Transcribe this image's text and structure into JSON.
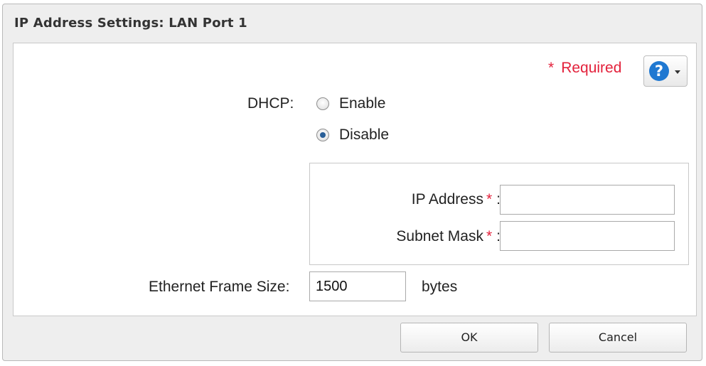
{
  "dialog": {
    "title": "IP Address Settings: LAN Port 1",
    "required_star": "*",
    "required_text": "Required",
    "help_icon_glyph": "?"
  },
  "dhcp": {
    "label": "DHCP:",
    "options": [
      {
        "label": "Enable",
        "checked": false
      },
      {
        "label": "Disable",
        "checked": true
      }
    ]
  },
  "fields": {
    "ip_address": {
      "label": "IP Address",
      "required_mark": "*",
      "colon": ":",
      "value": ""
    },
    "subnet_mask": {
      "label": "Subnet Mask",
      "required_mark": "*",
      "colon": ":",
      "value": ""
    },
    "frame_size": {
      "label": "Ethernet Frame Size:",
      "value": "1500",
      "unit": "bytes"
    }
  },
  "buttons": {
    "ok": "OK",
    "cancel": "Cancel"
  },
  "colors": {
    "required_red": "#e3213b",
    "help_blue": "#1f78d1",
    "dialog_bg": "#eeeeee"
  },
  "icons": {
    "help": "question-circle-icon",
    "dropdown": "caret-down-icon"
  }
}
